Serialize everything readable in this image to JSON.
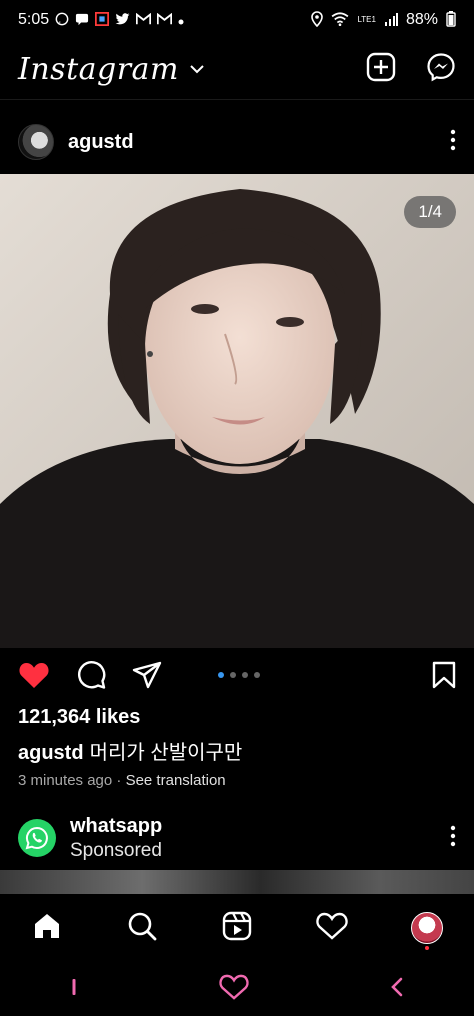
{
  "status_bar": {
    "time": "5:05",
    "battery": "88%",
    "network": "LTE1"
  },
  "header": {
    "title": "Instagram"
  },
  "post": {
    "username": "agustd",
    "image_counter": "1/4",
    "likes": "121,364 likes",
    "caption_user": "agustd",
    "caption_text": "머리가 산발이구만",
    "timestamp": "3 minutes ago",
    "separator": "·",
    "see_translation": "See translation",
    "slide_dots": {
      "total": 4,
      "active_index": 0
    }
  },
  "sponsored": {
    "name": "whatsapp",
    "label": "Sponsored"
  },
  "icons": {
    "status": [
      "whatsapp-icon",
      "message-icon",
      "app-icon",
      "twitter-icon",
      "gmail-icon",
      "gmail-icon",
      "dot-icon"
    ],
    "status_right": [
      "location-icon",
      "wifi-icon",
      "volte-icon",
      "signal-icon",
      "battery-icon"
    ],
    "header": [
      "chevron-down-icon",
      "new-post-icon",
      "messenger-icon"
    ],
    "post_actions": [
      "heart-icon",
      "comment-icon",
      "share-icon",
      "bookmark-icon"
    ],
    "nav": [
      "home-icon",
      "search-icon",
      "reels-icon",
      "activity-heart-icon",
      "profile-avatar"
    ],
    "system_nav": [
      "recents-icon",
      "home-heart-icon",
      "back-icon"
    ]
  },
  "colors": {
    "like_red": "#ff3040",
    "dot_blue": "#3897f0",
    "whatsapp_green": "#25d366",
    "system_heart_pink": "#f06ab0"
  }
}
